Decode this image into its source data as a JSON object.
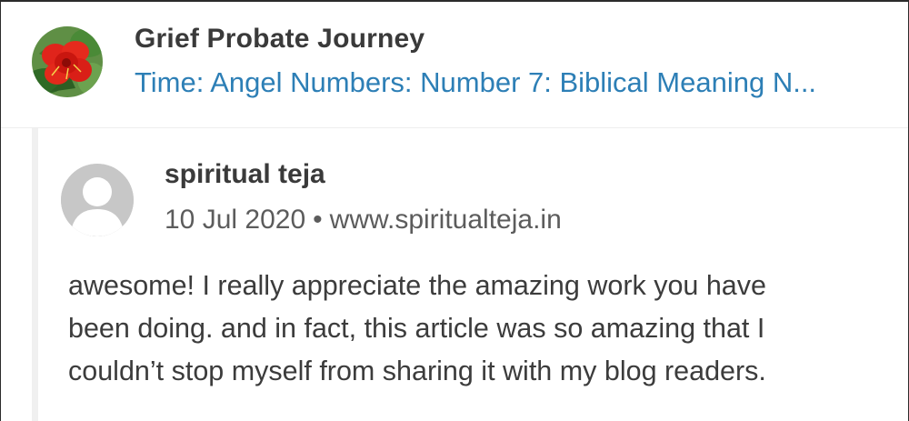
{
  "header": {
    "blog_title": "Grief Probate Journey",
    "post_link": "Time: Angel Numbers: Number 7: Biblical Meaning N...",
    "blog_avatar_icon": "red-flower-icon"
  },
  "comment": {
    "author": "spiritual teja",
    "date": "10 Jul 2020",
    "separator": "•",
    "website": "www.spiritualteja.in",
    "avatar_icon": "default-user-avatar-icon",
    "body_lines": [
      "awesome! I really appreciate the amazing work you have",
      "been doing. and in fact, this article was so amazing that I",
      "couldn’t stop myself from sharing it with my blog readers."
    ]
  },
  "colors": {
    "link": "#2d7fb6",
    "title": "#3a3a3a",
    "meta": "#5c5c5c",
    "avatar_placeholder": "#c7c7c7",
    "flower_red": "#e0241b",
    "leaf_green": "#3e7d2e"
  }
}
